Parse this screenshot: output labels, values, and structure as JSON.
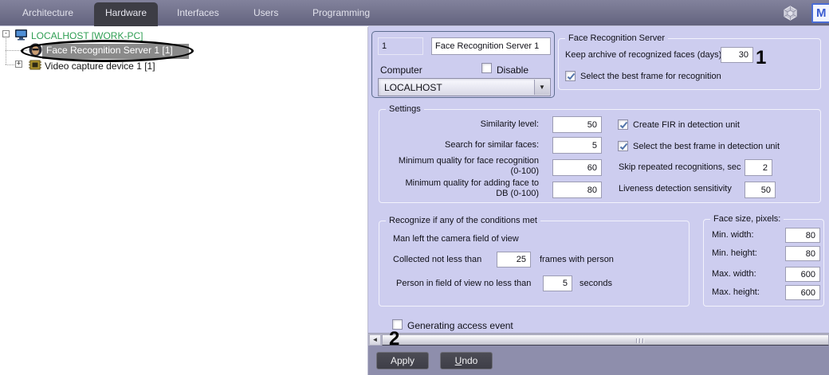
{
  "menu": {
    "items": [
      {
        "label": "Architecture"
      },
      {
        "label": "Hardware"
      },
      {
        "label": "Interfaces"
      },
      {
        "label": "Users"
      },
      {
        "label": "Programming"
      }
    ],
    "badge": "M"
  },
  "icons": {
    "collapse_glyph": "-",
    "expand_glyph": "+",
    "dropdown_arrow": "▼",
    "scroll_left_arrow": "◄"
  },
  "tree": {
    "root_label": "LOCALHOST [WORK-PC]",
    "items": [
      {
        "label": "Face Recognition Server 1 [1]",
        "selected": true
      },
      {
        "label": "Video capture device 1 [1]",
        "selected": false
      }
    ]
  },
  "identity": {
    "id_value": "1",
    "name_value": "Face Recognition Server 1",
    "computer_label": "Computer",
    "disable_label": "Disable",
    "disable_checked": false,
    "computer_value": "LOCALHOST"
  },
  "frs_group": {
    "title": "Face Recognition Server",
    "archive_label": "Keep archive of recognized faces (days):",
    "archive_value": "30",
    "best_frame_label": "Select the best frame for recognition",
    "best_frame_checked": true
  },
  "settings_group": {
    "title": "Settings",
    "similarity_label": "Similarity level:",
    "similarity_value": "50",
    "search_similar_label": "Search for similar faces:",
    "search_similar_value": "5",
    "min_quality_recognition_label": "Minimum quality for face recognition (0-100)",
    "min_quality_recognition_value": "60",
    "min_quality_db_label": "Minimum quality for adding face to DB (0-100)",
    "min_quality_db_value": "80",
    "create_fir_label": "Create FIR in detection unit",
    "create_fir_checked": true,
    "best_frame_detection_label": "Select the best frame in detection unit",
    "best_frame_detection_checked": true,
    "skip_repeated_label": "Skip repeated recognitions, sec",
    "skip_repeated_value": "2",
    "liveness_label": "Liveness detection sensitivity",
    "liveness_value": "50"
  },
  "conditions_group": {
    "title": "Recognize if any of the conditions met",
    "left_view_label": "Man left the camera field of view",
    "collected_prefix": "Collected not less than",
    "collected_value": "25",
    "collected_suffix": "frames with person",
    "person_prefix": "Person in field of view no less than",
    "person_value": "5",
    "person_suffix": "seconds"
  },
  "face_size_group": {
    "title": "Face size, pixels:",
    "rows": [
      {
        "label": "Min. width:",
        "value": "80"
      },
      {
        "label": "Min. height:",
        "value": "80"
      },
      {
        "label": "Max. width:",
        "value": "600"
      },
      {
        "label": "Max. height:",
        "value": "600"
      }
    ]
  },
  "footer": {
    "generating_label": "Generating access event",
    "generating_checked": false,
    "apply_label": "Apply",
    "undo_first": "U",
    "undo_rest": "ndo"
  },
  "annotations": {
    "one": "1",
    "two": "2"
  },
  "colors": {
    "panel_bg": "#cdcdef",
    "menubar_top": "#82829c",
    "menubar_bottom": "#63637e",
    "active_tab_bg": "#3d3d45",
    "bottom_strip_bg": "#8e8eac",
    "button_bg": "#44444d",
    "tree_root_green": "#2f9e53",
    "selection_gray": "#8a8a8a",
    "check_blue": "#5274aa"
  }
}
